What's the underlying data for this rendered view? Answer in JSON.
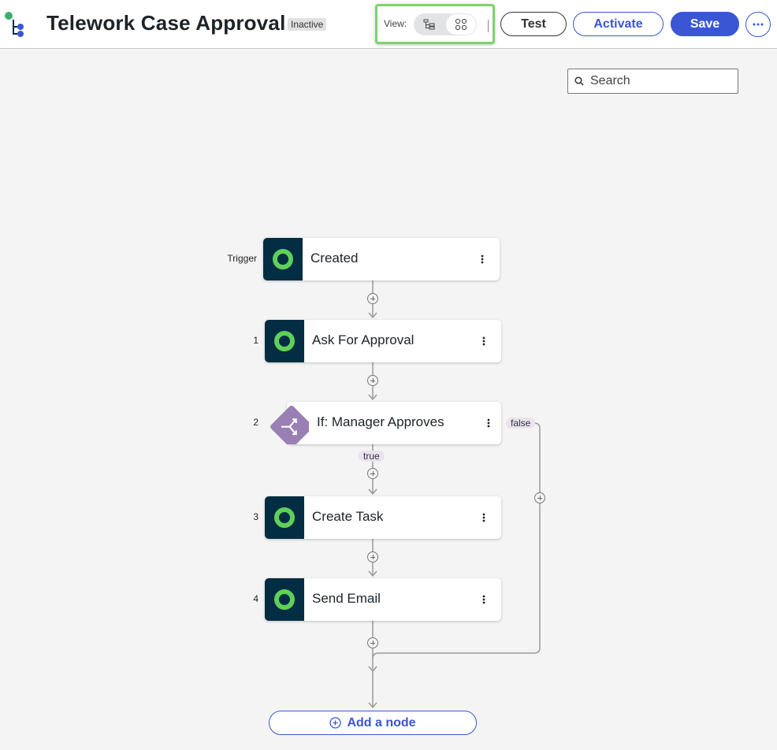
{
  "header": {
    "title": "Telework Case Approval",
    "status": "Inactive",
    "view_label": "View:",
    "buttons": {
      "test": "Test",
      "activate": "Activate",
      "save": "Save"
    }
  },
  "search": {
    "placeholder": "Search"
  },
  "flow": {
    "trigger": {
      "step": "Trigger",
      "label": "Created"
    },
    "steps": [
      {
        "step": "1",
        "label": "Ask For Approval"
      },
      {
        "step": "2",
        "label": "If: Manager Approves"
      },
      {
        "step": "3",
        "label": "Create Task"
      },
      {
        "step": "4",
        "label": "Send Email"
      }
    ],
    "branch_true": "true",
    "branch_false": "false",
    "add_node": "Add a node"
  },
  "colors": {
    "accent": "#3a56d4",
    "node_icon_bg": "#032d42",
    "node_icon_ring": "#5fd05a",
    "decision_bg": "#9a7fb5",
    "highlight": "#7ed36b"
  }
}
